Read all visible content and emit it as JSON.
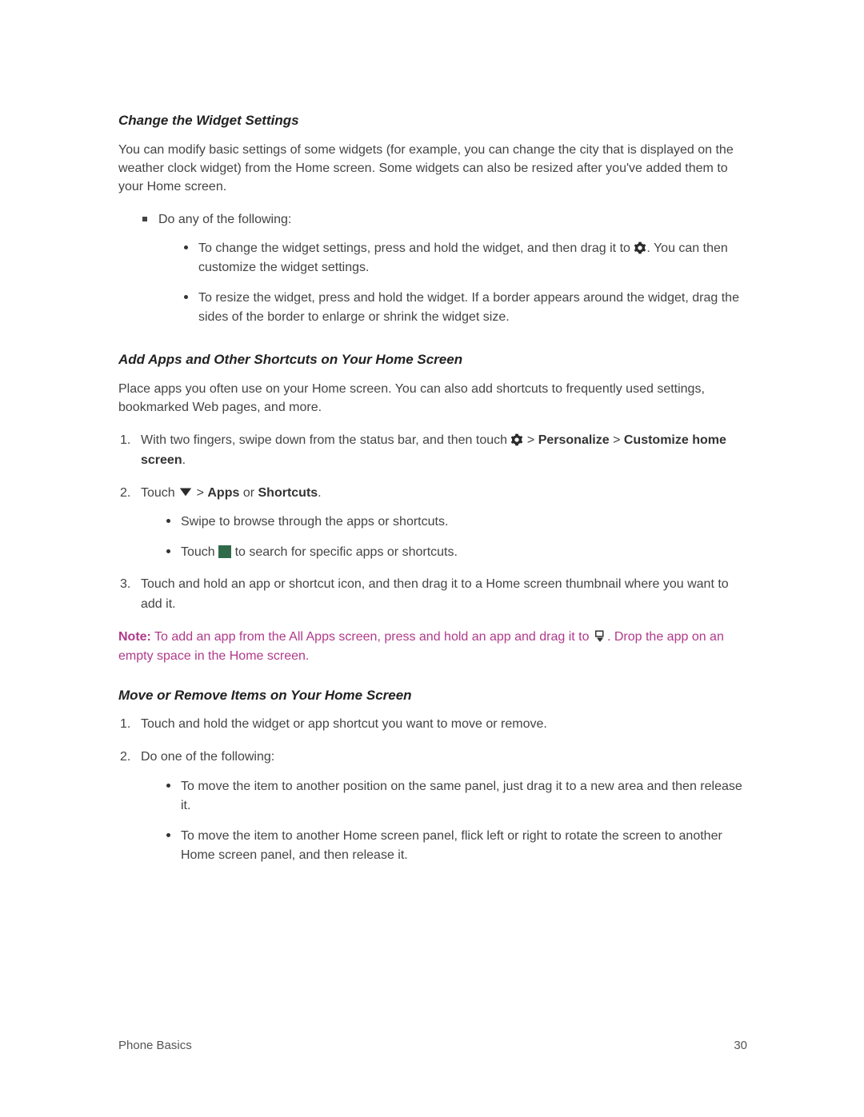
{
  "section1": {
    "heading": "Change the Widget Settings",
    "intro": "You can modify basic settings of some widgets (for example, you can change the city that is displayed on the weather clock widget) from the Home screen. Some widgets can also be resized after you've added them to your Home screen.",
    "lead": "Do any of the following:",
    "bullet1_a": "To change the widget settings, press and hold the widget, and then drag it to ",
    "bullet1_b": ". You can then customize the widget settings.",
    "bullet2": "To resize the widget, press and hold the widget. If a border appears around the widget, drag the sides of the border to enlarge or shrink the widget size."
  },
  "section2": {
    "heading": "Add Apps and Other Shortcuts on Your Home Screen",
    "intro": "Place apps you often use on your Home screen. You can also add shortcuts to frequently used settings, bookmarked Web pages, and more.",
    "step1_a": "With two fingers, swipe down from the status bar, and then touch ",
    "step1_b": " > ",
    "step1_personalize": "Personalize",
    "step1_c": " > ",
    "step1_customize": "Customize home screen",
    "step1_d": ".",
    "step2_a": "Touch ",
    "step2_b": " > ",
    "step2_apps": "Apps",
    "step2_or": " or ",
    "step2_shortcuts": "Shortcuts",
    "step2_c": ".",
    "sub_a": "Swipe to browse through the apps or shortcuts.",
    "sub_b1": "Touch ",
    "sub_b2": " to search for specific apps or shortcuts.",
    "step3": "Touch and hold an app or shortcut icon, and then drag it to a Home screen thumbnail where you want to add it.",
    "note_label": "Note:",
    "note_a": "To add an app from the All Apps screen, press and hold an app and drag it to ",
    "note_b": ". Drop the app on an empty space in the Home screen."
  },
  "section3": {
    "heading": "Move or Remove Items on Your Home Screen",
    "step1": "Touch and hold the widget or app shortcut you want to move or remove.",
    "step2_lead": "Do one of the following:",
    "sub_a": "To move the item to another position on the same panel, just drag it to a new area and then release it.",
    "sub_b": "To move the item to another Home screen panel, flick left or right to rotate the screen to another Home screen panel, and then release it."
  },
  "footer": {
    "left": "Phone Basics",
    "right": "30"
  }
}
